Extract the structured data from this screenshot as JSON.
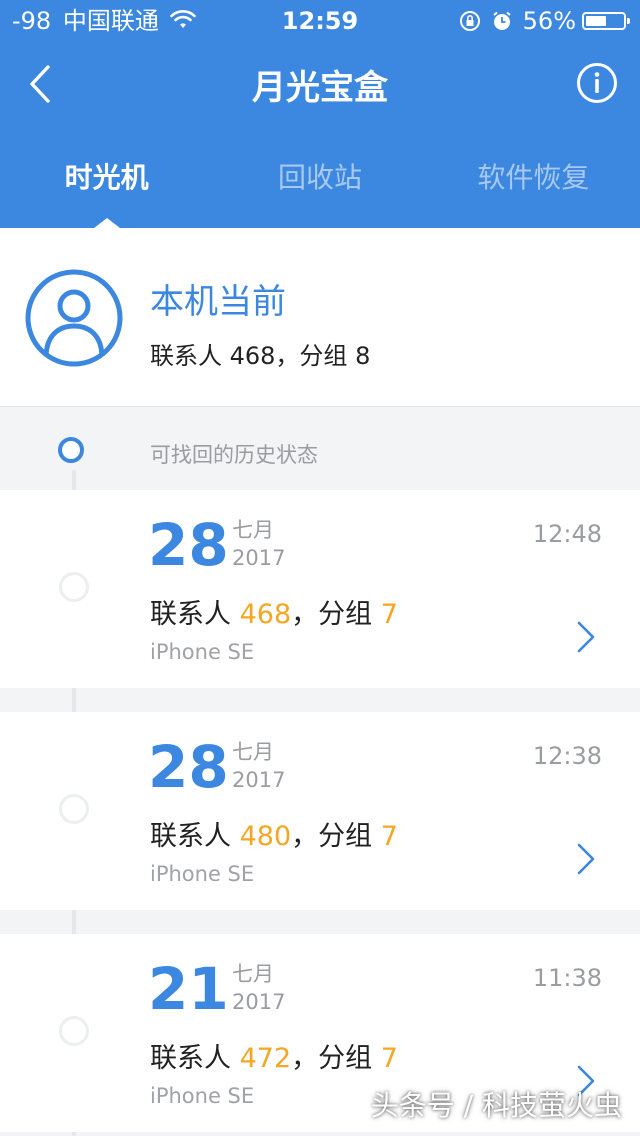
{
  "status_bar": {
    "signal": "-98",
    "carrier": "中国联通",
    "time": "12:59",
    "battery": "56%",
    "battery_level": 0.56
  },
  "nav": {
    "title": "月光宝盒",
    "back_icon": "back-arrow-icon",
    "info_icon": "info-icon"
  },
  "tabs": [
    {
      "label": "时光机",
      "active": true
    },
    {
      "label": "回收站",
      "active": false
    },
    {
      "label": "软件恢复",
      "active": false
    }
  ],
  "current": {
    "title": "本机当前",
    "subtitle": "联系人 468，分组 8"
  },
  "history": {
    "label": "可找回的历史状态",
    "records": [
      {
        "day": "28",
        "month": "七月",
        "year": "2017",
        "time": "12:48",
        "contacts_label": "联系人 ",
        "contacts": "468",
        "groups_label": "，分组 ",
        "groups": "7",
        "device": "iPhone SE"
      },
      {
        "day": "28",
        "month": "七月",
        "year": "2017",
        "time": "12:38",
        "contacts_label": "联系人 ",
        "contacts": "480",
        "groups_label": "，分组 ",
        "groups": "7",
        "device": "iPhone SE"
      },
      {
        "day": "21",
        "month": "七月",
        "year": "2017",
        "time": "11:38",
        "contacts_label": "联系人 ",
        "contacts": "472",
        "groups_label": "，分组 ",
        "groups": "7",
        "device": "iPhone SE"
      }
    ]
  },
  "watermark": "头条号 / 科技萤火虫",
  "colors": {
    "primary": "#3c87e0",
    "accent": "#f5a623",
    "background": "#f3f4f6"
  }
}
